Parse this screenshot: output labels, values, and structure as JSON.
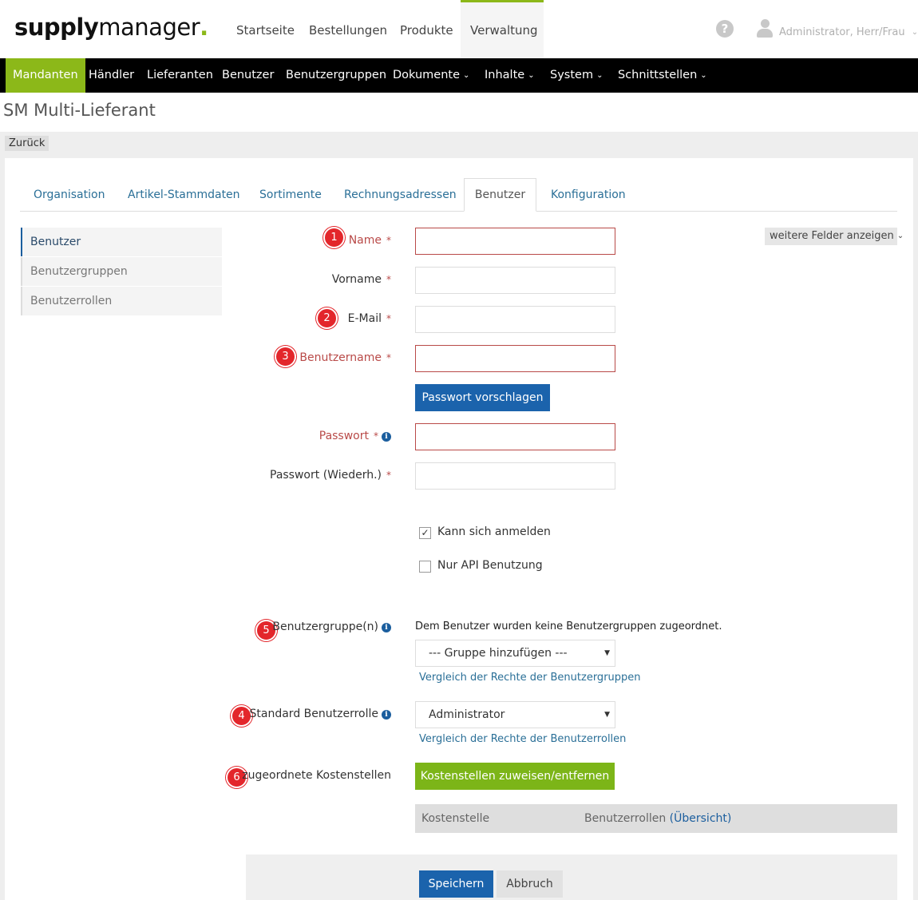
{
  "header": {
    "logo_bold": "supply",
    "logo_light": "manager",
    "logo_dot": ".",
    "nav": [
      "Startseite",
      "Bestellungen",
      "Produkte",
      "Verwaltung"
    ],
    "help_glyph": "?",
    "user_label": "Administrator, Herr/Frau"
  },
  "subnav": {
    "items": [
      "Mandanten",
      "Händler",
      "Lieferanten",
      "Benutzer",
      "Benutzergruppen",
      "Dokumente",
      "Inhalte",
      "System",
      "Schnittstellen"
    ]
  },
  "page": {
    "title": "SM Multi-Lieferant",
    "back_label": "Zurück"
  },
  "tabs": [
    "Organisation",
    "Artikel-Stammdaten",
    "Sortimente",
    "Rechnungsadressen",
    "Benutzer",
    "Konfiguration"
  ],
  "side_menu": [
    "Benutzer",
    "Benutzergruppen",
    "Benutzerrollen"
  ],
  "form": {
    "more_fields": "weitere Felder anzeigen",
    "name": "Name",
    "vorname": "Vorname",
    "email": "E-Mail",
    "benutzername": "Benutzername",
    "suggest_password": "Passwort vorschlagen",
    "passwort": "Passwort",
    "passwort_repeat": "Passwort (Wiederh.)",
    "required_mark": "*",
    "info_glyph": "i",
    "can_login": "Kann sich anmelden",
    "api_only": "Nur API Benutzung",
    "groups_label": "Benutzergruppe(n)",
    "groups_text": "Dem Benutzer wurden keine Benutzergruppen zugeordnet.",
    "group_select": "--- Gruppe hinzufügen ---",
    "groups_link": "Vergleich der Rechte der Benutzergruppen",
    "role_label": "Standard Benutzerrolle",
    "role_select": "Administrator",
    "roles_link": "Vergleich der Rechte der Benutzerrollen",
    "cost_label": "zugeordnete Kostenstellen",
    "cost_button": "Kostenstellen zuweisen/entfernen",
    "table_col1": "Kostenstelle",
    "table_col2": "Benutzerrollen",
    "table_col2_link": "(Übersicht)",
    "save": "Speichern",
    "cancel": "Abbruch"
  },
  "badges": [
    "1",
    "2",
    "3",
    "5",
    "4",
    "6"
  ],
  "check_glyph": "✓",
  "select_arrow": "▼",
  "chevron_glyph": "⌄"
}
